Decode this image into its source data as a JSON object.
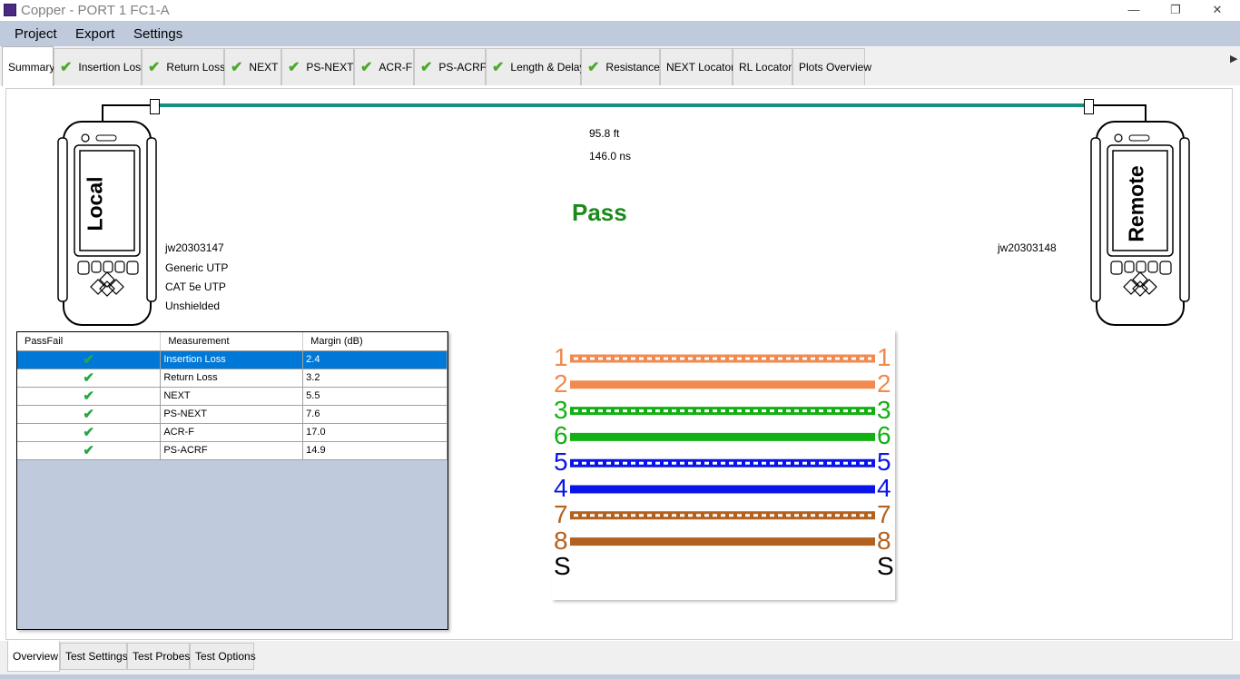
{
  "window": {
    "title": "Copper - PORT 1 FC1-A",
    "minimize": "—",
    "maximize": "❐",
    "close": "✕"
  },
  "menu": [
    "Project",
    "Export",
    "Settings"
  ],
  "tabs": [
    {
      "label": "Summary",
      "check": false,
      "active": true
    },
    {
      "label": "Insertion Loss",
      "check": true
    },
    {
      "label": "Return Loss",
      "check": true
    },
    {
      "label": "NEXT",
      "check": true
    },
    {
      "label": "PS-NEXT",
      "check": true
    },
    {
      "label": "ACR-F",
      "check": true
    },
    {
      "label": "PS-ACRF",
      "check": true
    },
    {
      "label": "Length & Delay",
      "check": true
    },
    {
      "label": "Resistance",
      "check": true
    },
    {
      "label": "NEXT Locator",
      "check": false
    },
    {
      "label": "RL Locator",
      "check": false
    },
    {
      "label": "Plots Overview",
      "check": false
    }
  ],
  "summary": {
    "length": "95.8 ft",
    "delay": "146.0 ns",
    "result": "Pass",
    "local_label": "Local",
    "remote_label": "Remote",
    "local_id": "jw20303147",
    "remote_id": "jw20303148",
    "cable_type": "Generic UTP",
    "category": "CAT 5e UTP",
    "shielding": "Unshielded"
  },
  "results_table": {
    "columns": [
      "PassFail",
      "Measurement",
      "Margin (dB)"
    ],
    "rows": [
      {
        "pass": "✔",
        "measurement": "Insertion Loss",
        "margin": "2.4",
        "selected": true
      },
      {
        "pass": "✔",
        "measurement": "Return Loss",
        "margin": "3.2"
      },
      {
        "pass": "✔",
        "measurement": "NEXT",
        "margin": "5.5"
      },
      {
        "pass": "✔",
        "measurement": "PS-NEXT",
        "margin": "7.6"
      },
      {
        "pass": "✔",
        "measurement": "ACR-F",
        "margin": "17.0"
      },
      {
        "pass": "✔",
        "measurement": "PS-ACRF",
        "margin": "14.9"
      }
    ]
  },
  "wiremap": [
    {
      "pin": "1",
      "color": "#f28a4f",
      "striped": true
    },
    {
      "pin": "2",
      "color": "#f28a4f",
      "striped": false
    },
    {
      "pin": "3",
      "color": "#12b012",
      "striped": true
    },
    {
      "pin": "6",
      "color": "#12b012",
      "striped": false
    },
    {
      "pin": "5",
      "color": "#0a14e8",
      "striped": true
    },
    {
      "pin": "4",
      "color": "#0a14e8",
      "striped": false
    },
    {
      "pin": "7",
      "color": "#b3611e",
      "striped": true
    },
    {
      "pin": "8",
      "color": "#b3611e",
      "striped": false
    },
    {
      "pin": "S",
      "color": "#000000",
      "striped": null
    }
  ],
  "bottom_tabs": [
    "Overview",
    "Test Settings",
    "Test Probes",
    "Test Options"
  ]
}
